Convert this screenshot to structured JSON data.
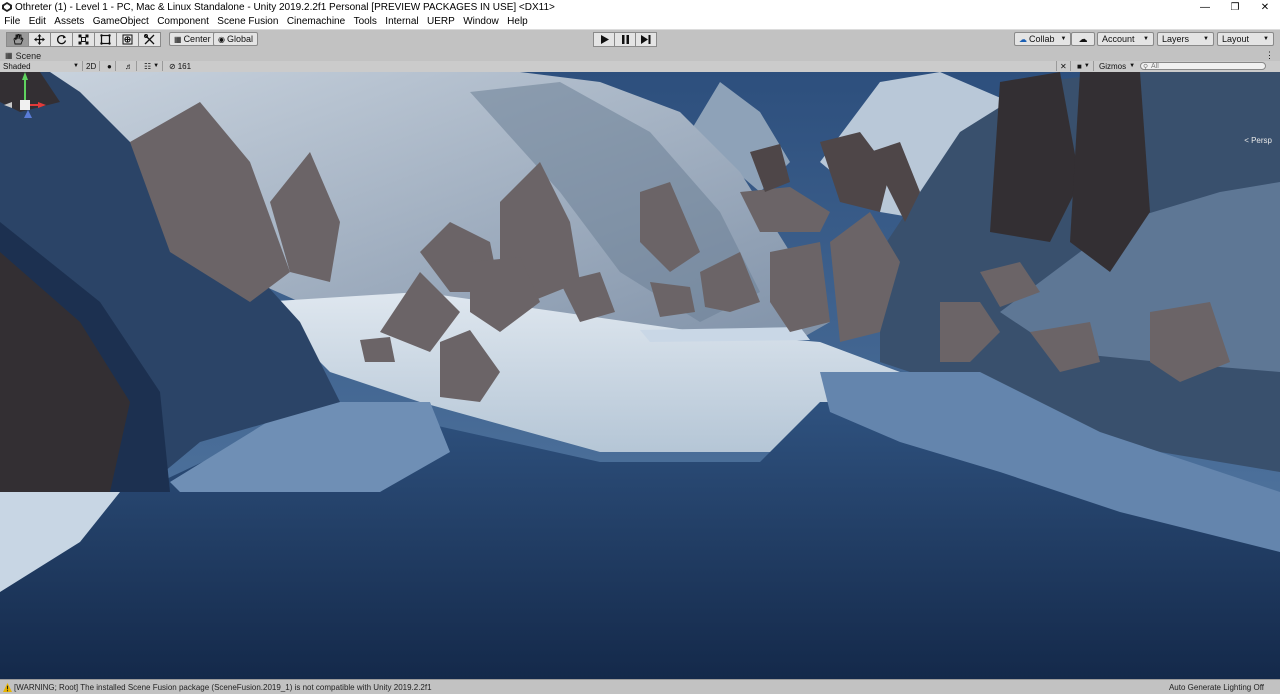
{
  "window": {
    "title": "Othreter (1) - Level 1 - PC, Mac & Linux Standalone - Unity 2019.2.2f1 Personal [PREVIEW PACKAGES IN USE] <DX11>",
    "minimize": "—",
    "maximize": "❐",
    "close": "✕"
  },
  "menu": [
    "File",
    "Edit",
    "Assets",
    "GameObject",
    "Component",
    "Scene Fusion",
    "Cinemachine",
    "Tools",
    "Internal",
    "UERP",
    "Window",
    "Help"
  ],
  "toolbar": {
    "tools": [
      "hand-tool",
      "move-tool",
      "rotate-tool",
      "scale-tool",
      "rect-tool",
      "transform-tool",
      "custom-tool"
    ],
    "pivot_label": "Center",
    "space_label": "Global",
    "collab_label": "Collab",
    "account_label": "Account",
    "layers_label": "Layers",
    "layout_label": "Layout"
  },
  "scene_tab": {
    "label": "Scene",
    "shading_mode": "Shaded",
    "mode_2d": "2D",
    "hidden_count": "161",
    "gizmos_label": "Gizmos",
    "search_placeholder": "All"
  },
  "viewport": {
    "projection_label": "Persp"
  },
  "status": {
    "warning": "[WARNING; Root] The installed Scene Fusion package (SceneFusion.2019_1) is not compatible with Unity 2019.2.2f1",
    "lighting": "Auto Generate Lighting Off"
  },
  "colors": {
    "editor_bg": "#c2c2c2",
    "sky": "#3b5c86",
    "snow": "#e4ecf3",
    "ice": "#27466f",
    "rock": "#6b6467"
  }
}
